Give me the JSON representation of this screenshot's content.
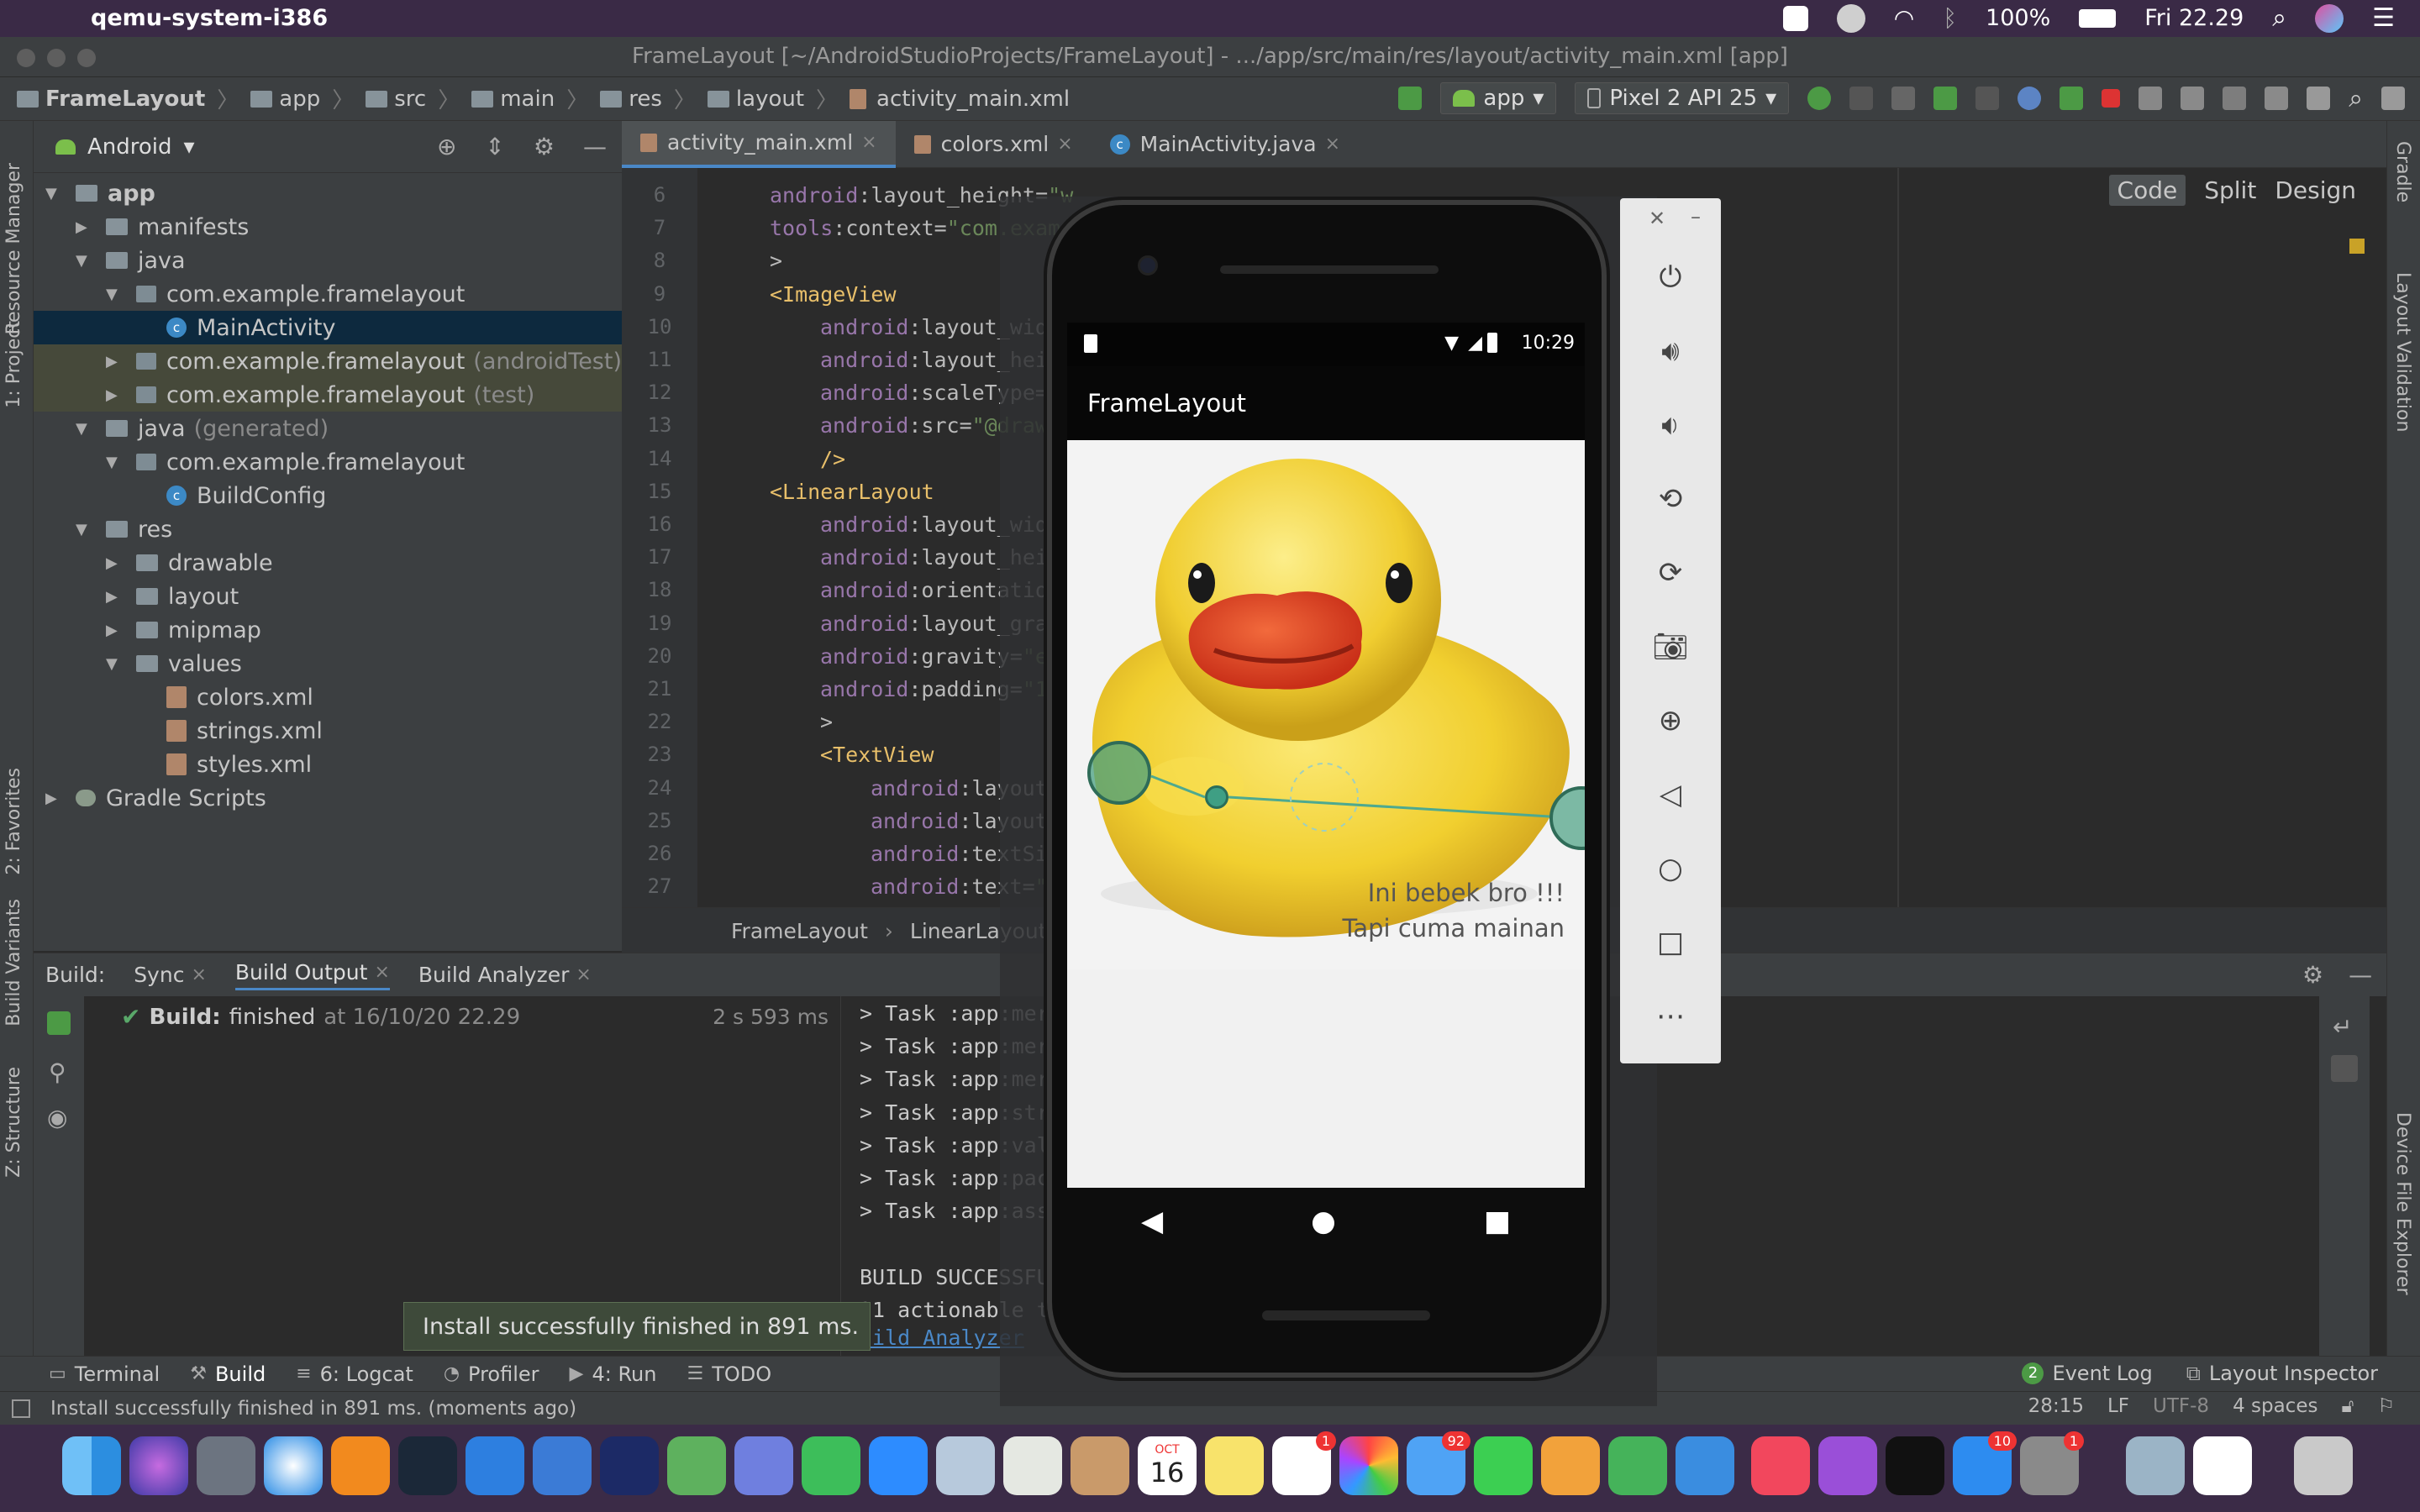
{
  "menubar": {
    "app_name": "qemu-system-i386",
    "battery": "100%",
    "clock": "Fri 22.29"
  },
  "window": {
    "title": "FrameLayout [~/AndroidStudioProjects/FrameLayout] - .../app/src/main/res/layout/activity_main.xml [app]"
  },
  "navbar": {
    "crumbs": [
      "FrameLayout",
      "app",
      "src",
      "main",
      "res",
      "layout",
      "activity_main.xml"
    ],
    "run_config": "app",
    "device": "Pixel 2 API 25"
  },
  "project": {
    "view_selector": "Android",
    "tree": [
      {
        "label": "app",
        "depth": 0,
        "expanded": true,
        "kind": "folder"
      },
      {
        "label": "manifests",
        "depth": 1,
        "expanded": false,
        "kind": "folder"
      },
      {
        "label": "java",
        "depth": 1,
        "expanded": true,
        "kind": "folder"
      },
      {
        "label": "com.example.framelayout",
        "depth": 2,
        "expanded": true,
        "kind": "package"
      },
      {
        "label": "MainActivity",
        "depth": 3,
        "kind": "class",
        "selected": true
      },
      {
        "label": "com.example.framelayout",
        "suffix": "(androidTest)",
        "depth": 2,
        "expanded": false,
        "kind": "package",
        "test": true
      },
      {
        "label": "com.example.framelayout",
        "suffix": "(test)",
        "depth": 2,
        "expanded": false,
        "kind": "package",
        "test": true
      },
      {
        "label": "java",
        "suffix": "(generated)",
        "depth": 1,
        "expanded": true,
        "kind": "folder"
      },
      {
        "label": "com.example.framelayout",
        "depth": 2,
        "expanded": true,
        "kind": "package"
      },
      {
        "label": "BuildConfig",
        "depth": 3,
        "kind": "class"
      },
      {
        "label": "res",
        "depth": 1,
        "expanded": true,
        "kind": "folder"
      },
      {
        "label": "drawable",
        "depth": 2,
        "expanded": false,
        "kind": "folder"
      },
      {
        "label": "layout",
        "depth": 2,
        "expanded": false,
        "kind": "folder"
      },
      {
        "label": "mipmap",
        "depth": 2,
        "expanded": false,
        "kind": "folder"
      },
      {
        "label": "values",
        "depth": 2,
        "expanded": true,
        "kind": "folder"
      },
      {
        "label": "colors.xml",
        "depth": 3,
        "kind": "xml"
      },
      {
        "label": "strings.xml",
        "depth": 3,
        "kind": "xml"
      },
      {
        "label": "styles.xml",
        "depth": 3,
        "kind": "xml"
      },
      {
        "label": "Gradle Scripts",
        "depth": 0,
        "expanded": false,
        "kind": "gradle"
      }
    ]
  },
  "left_stripe": [
    "Resource Manager",
    "1: Project",
    "2: Favorites",
    "Build Variants",
    "Z: Structure"
  ],
  "right_stripe": [
    "Gradle",
    "Layout Validation",
    "Device File Explorer"
  ],
  "editor": {
    "tabs": [
      {
        "label": "activity_main.xml",
        "active": true
      },
      {
        "label": "colors.xml",
        "active": false
      },
      {
        "label": "MainActivity.java",
        "active": false
      }
    ],
    "view_modes": [
      "Code",
      "Split",
      "Design"
    ],
    "lines": [
      {
        "n": "6",
        "indent": 0,
        "parts": [
          [
            "ns",
            "android"
          ],
          [
            "attr",
            ":layout_height="
          ],
          [
            "str",
            "\"w"
          ]
        ]
      },
      {
        "n": "7",
        "indent": 0,
        "parts": [
          [
            "ns",
            "tools"
          ],
          [
            "attr",
            ":context="
          ],
          [
            "str",
            "\"com.examp"
          ]
        ]
      },
      {
        "n": "8",
        "indent": 0,
        "parts": [
          [
            "attr",
            ">"
          ]
        ]
      },
      {
        "n": "9",
        "indent": 0,
        "parts": [
          [
            "tag",
            "<ImageView"
          ]
        ]
      },
      {
        "n": "10",
        "indent": 1,
        "parts": [
          [
            "ns",
            "android"
          ],
          [
            "attr",
            ":layout_widtl"
          ]
        ]
      },
      {
        "n": "11",
        "indent": 1,
        "parts": [
          [
            "ns",
            "android"
          ],
          [
            "attr",
            ":layout_heig"
          ]
        ]
      },
      {
        "n": "12",
        "indent": 1,
        "parts": [
          [
            "ns",
            "android"
          ],
          [
            "attr",
            ":scaleType="
          ],
          [
            "str",
            "\""
          ]
        ]
      },
      {
        "n": "13",
        "indent": 1,
        "parts": [
          [
            "ns",
            "android"
          ],
          [
            "attr",
            ":src="
          ],
          [
            "str",
            "\"@drawa"
          ]
        ]
      },
      {
        "n": "14",
        "indent": 1,
        "parts": [
          [
            "tag",
            "/>"
          ]
        ]
      },
      {
        "n": "15",
        "indent": 0,
        "parts": [
          [
            "tag",
            "<LinearLayout"
          ]
        ]
      },
      {
        "n": "16",
        "indent": 1,
        "parts": [
          [
            "ns",
            "android"
          ],
          [
            "attr",
            ":layout_widtl"
          ]
        ]
      },
      {
        "n": "17",
        "indent": 1,
        "parts": [
          [
            "ns",
            "android"
          ],
          [
            "attr",
            ":layout_heig"
          ]
        ]
      },
      {
        "n": "18",
        "indent": 1,
        "parts": [
          [
            "ns",
            "android"
          ],
          [
            "attr",
            ":orientation"
          ]
        ]
      },
      {
        "n": "19",
        "indent": 1,
        "parts": [
          [
            "ns",
            "android"
          ],
          [
            "attr",
            ":layout_grav"
          ]
        ]
      },
      {
        "n": "20",
        "indent": 1,
        "parts": [
          [
            "ns",
            "android"
          ],
          [
            "attr",
            ":gravity="
          ],
          [
            "str",
            "\"en"
          ]
        ]
      },
      {
        "n": "21",
        "indent": 1,
        "parts": [
          [
            "ns",
            "android"
          ],
          [
            "attr",
            ":padding="
          ],
          [
            "str",
            "\"16"
          ]
        ]
      },
      {
        "n": "22",
        "indent": 1,
        "parts": [
          [
            "attr",
            ">"
          ]
        ]
      },
      {
        "n": "23",
        "indent": 1,
        "parts": [
          [
            "tag",
            "<TextView"
          ]
        ]
      },
      {
        "n": "24",
        "indent": 2,
        "parts": [
          [
            "ns",
            "android"
          ],
          [
            "attr",
            ":layout_v"
          ]
        ]
      },
      {
        "n": "25",
        "indent": 2,
        "parts": [
          [
            "ns",
            "android"
          ],
          [
            "attr",
            ":layout_"
          ]
        ]
      },
      {
        "n": "26",
        "indent": 2,
        "parts": [
          [
            "ns",
            "android"
          ],
          [
            "attr",
            ":textSiz"
          ]
        ]
      },
      {
        "n": "27",
        "indent": 2,
        "parts": [
          [
            "ns",
            "android"
          ],
          [
            "attr",
            ":text="
          ],
          [
            "str",
            "\"I"
          ]
        ]
      }
    ],
    "breadcrumb": [
      "FrameLayout",
      "LinearLayout"
    ]
  },
  "build": {
    "label": "Build:",
    "tabs": [
      "Sync",
      "Build Output",
      "Build Analyzer"
    ],
    "result_title": "Build:",
    "result_status": "finished",
    "result_time": "at 16/10/20 22.29",
    "duration": "2 s 593 ms",
    "console": [
      "> Task :app:merg",
      "> Task :app:merg",
      "> Task :app:merg",
      "> Task :app:stri",
      "> Task :app:vali",
      "> Task :app:pack",
      "> Task :app:asse",
      "",
      "BUILD SUCCESSFUL",
      "21 actionable ta"
    ],
    "analyzer_link": "uild Analyzer"
  },
  "toast": "Install successfully finished in 891 ms.",
  "bottom_tools": [
    {
      "label": "Terminal"
    },
    {
      "label": "Build",
      "active": true
    },
    {
      "label": "6: Logcat"
    },
    {
      "label": "Profiler"
    },
    {
      "label": "4: Run"
    },
    {
      "label": "TODO"
    }
  ],
  "bottom_tools_right": [
    {
      "label": "Event Log",
      "badge": "2"
    },
    {
      "label": "Layout Inspector"
    }
  ],
  "statusbar": {
    "message": "Install successfully finished in 891 ms. (moments ago)",
    "position": "28:15",
    "line_sep": "LF",
    "encoding": "UTF-8",
    "indent": "4 spaces"
  },
  "emulator": {
    "status_time": "10:29",
    "app_title": "FrameLayout",
    "overlay_line1": "Ini bebek bro !!!",
    "overlay_line2": "Tapi cuma mainan",
    "side_controls": [
      "power-icon",
      "volume-up-icon",
      "volume-down-icon",
      "rotate-left-icon",
      "rotate-right-icon",
      "camera-icon",
      "zoom-icon",
      "back-icon",
      "home-icon",
      "overview-icon",
      "more-icon"
    ]
  },
  "dock": {
    "calendar_month": "OCT",
    "calendar_day": "16",
    "badges": {
      "reminders": "1",
      "messages": "92",
      "appstore": "10",
      "prefs": "1"
    }
  },
  "colors": {
    "accent": "#4a88c7",
    "success": "#59a869",
    "duck_yellow": "#f3d23a"
  }
}
